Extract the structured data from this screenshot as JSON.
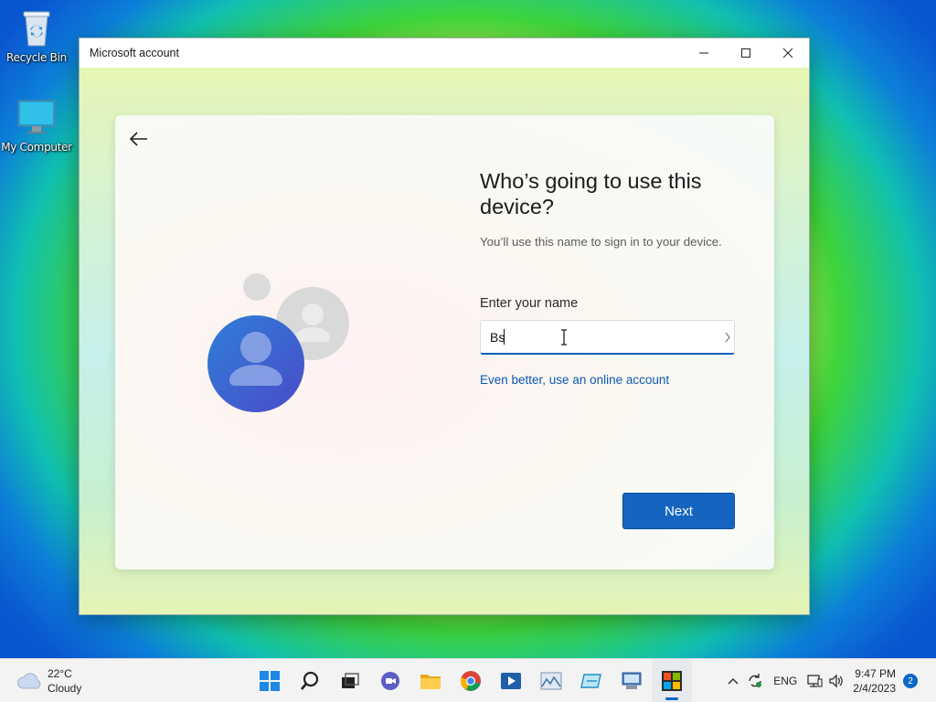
{
  "desktop": {
    "icons": [
      {
        "label": "Recycle Bin",
        "icon": "recycle-bin-icon"
      },
      {
        "label": "My Computer",
        "icon": "computer-icon"
      }
    ]
  },
  "window": {
    "title": "Microsoft account",
    "controls": [
      "minimize",
      "maximize",
      "close"
    ]
  },
  "setup": {
    "heading": "Who’s going to use this device?",
    "subtext": "You’ll use this name to sign in to your device.",
    "name_label": "Enter your name",
    "name_value": "Bs",
    "online_link": "Even better, use an online account",
    "next_label": "Next"
  },
  "taskbar": {
    "weather": {
      "temp": "22°C",
      "condition": "Cloudy"
    },
    "apps": [
      "start",
      "search",
      "task-view",
      "chat",
      "file-explorer",
      "chrome",
      "media-player",
      "photos",
      "app",
      "remote-desktop",
      "store"
    ],
    "language": "ENG",
    "time": "9:47 PM",
    "date": "2/4/2023",
    "notifications": "2"
  },
  "colors": {
    "accent": "#1565c0",
    "link": "#0a59b0"
  }
}
